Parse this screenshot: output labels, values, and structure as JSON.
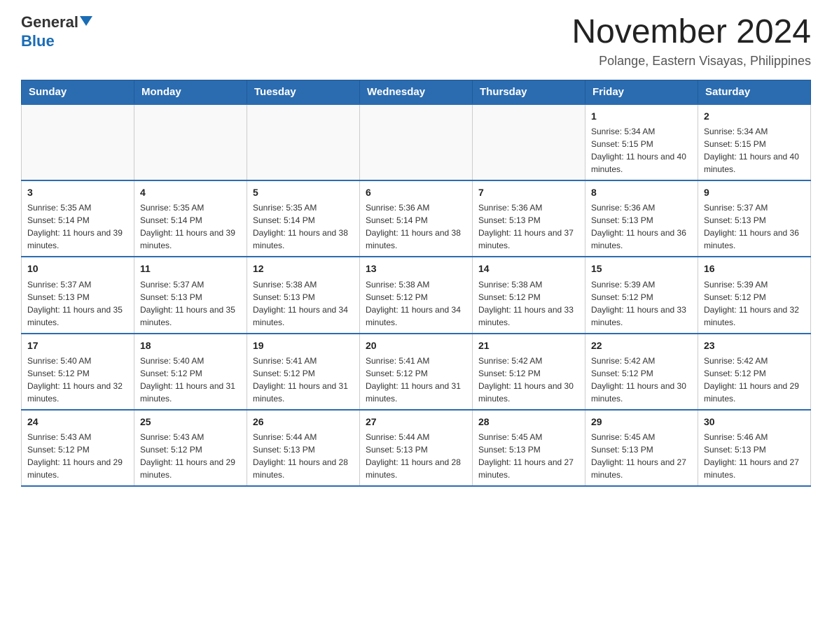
{
  "logo": {
    "text_general": "General",
    "text_blue": "Blue"
  },
  "header": {
    "month_year": "November 2024",
    "location": "Polange, Eastern Visayas, Philippines"
  },
  "days_of_week": [
    "Sunday",
    "Monday",
    "Tuesday",
    "Wednesday",
    "Thursday",
    "Friday",
    "Saturday"
  ],
  "weeks": [
    {
      "days": [
        {
          "num": "",
          "info": ""
        },
        {
          "num": "",
          "info": ""
        },
        {
          "num": "",
          "info": ""
        },
        {
          "num": "",
          "info": ""
        },
        {
          "num": "",
          "info": ""
        },
        {
          "num": "1",
          "info": "Sunrise: 5:34 AM\nSunset: 5:15 PM\nDaylight: 11 hours and 40 minutes."
        },
        {
          "num": "2",
          "info": "Sunrise: 5:34 AM\nSunset: 5:15 PM\nDaylight: 11 hours and 40 minutes."
        }
      ]
    },
    {
      "days": [
        {
          "num": "3",
          "info": "Sunrise: 5:35 AM\nSunset: 5:14 PM\nDaylight: 11 hours and 39 minutes."
        },
        {
          "num": "4",
          "info": "Sunrise: 5:35 AM\nSunset: 5:14 PM\nDaylight: 11 hours and 39 minutes."
        },
        {
          "num": "5",
          "info": "Sunrise: 5:35 AM\nSunset: 5:14 PM\nDaylight: 11 hours and 38 minutes."
        },
        {
          "num": "6",
          "info": "Sunrise: 5:36 AM\nSunset: 5:14 PM\nDaylight: 11 hours and 38 minutes."
        },
        {
          "num": "7",
          "info": "Sunrise: 5:36 AM\nSunset: 5:13 PM\nDaylight: 11 hours and 37 minutes."
        },
        {
          "num": "8",
          "info": "Sunrise: 5:36 AM\nSunset: 5:13 PM\nDaylight: 11 hours and 36 minutes."
        },
        {
          "num": "9",
          "info": "Sunrise: 5:37 AM\nSunset: 5:13 PM\nDaylight: 11 hours and 36 minutes."
        }
      ]
    },
    {
      "days": [
        {
          "num": "10",
          "info": "Sunrise: 5:37 AM\nSunset: 5:13 PM\nDaylight: 11 hours and 35 minutes."
        },
        {
          "num": "11",
          "info": "Sunrise: 5:37 AM\nSunset: 5:13 PM\nDaylight: 11 hours and 35 minutes."
        },
        {
          "num": "12",
          "info": "Sunrise: 5:38 AM\nSunset: 5:13 PM\nDaylight: 11 hours and 34 minutes."
        },
        {
          "num": "13",
          "info": "Sunrise: 5:38 AM\nSunset: 5:12 PM\nDaylight: 11 hours and 34 minutes."
        },
        {
          "num": "14",
          "info": "Sunrise: 5:38 AM\nSunset: 5:12 PM\nDaylight: 11 hours and 33 minutes."
        },
        {
          "num": "15",
          "info": "Sunrise: 5:39 AM\nSunset: 5:12 PM\nDaylight: 11 hours and 33 minutes."
        },
        {
          "num": "16",
          "info": "Sunrise: 5:39 AM\nSunset: 5:12 PM\nDaylight: 11 hours and 32 minutes."
        }
      ]
    },
    {
      "days": [
        {
          "num": "17",
          "info": "Sunrise: 5:40 AM\nSunset: 5:12 PM\nDaylight: 11 hours and 32 minutes."
        },
        {
          "num": "18",
          "info": "Sunrise: 5:40 AM\nSunset: 5:12 PM\nDaylight: 11 hours and 31 minutes."
        },
        {
          "num": "19",
          "info": "Sunrise: 5:41 AM\nSunset: 5:12 PM\nDaylight: 11 hours and 31 minutes."
        },
        {
          "num": "20",
          "info": "Sunrise: 5:41 AM\nSunset: 5:12 PM\nDaylight: 11 hours and 31 minutes."
        },
        {
          "num": "21",
          "info": "Sunrise: 5:42 AM\nSunset: 5:12 PM\nDaylight: 11 hours and 30 minutes."
        },
        {
          "num": "22",
          "info": "Sunrise: 5:42 AM\nSunset: 5:12 PM\nDaylight: 11 hours and 30 minutes."
        },
        {
          "num": "23",
          "info": "Sunrise: 5:42 AM\nSunset: 5:12 PM\nDaylight: 11 hours and 29 minutes."
        }
      ]
    },
    {
      "days": [
        {
          "num": "24",
          "info": "Sunrise: 5:43 AM\nSunset: 5:12 PM\nDaylight: 11 hours and 29 minutes."
        },
        {
          "num": "25",
          "info": "Sunrise: 5:43 AM\nSunset: 5:12 PM\nDaylight: 11 hours and 29 minutes."
        },
        {
          "num": "26",
          "info": "Sunrise: 5:44 AM\nSunset: 5:13 PM\nDaylight: 11 hours and 28 minutes."
        },
        {
          "num": "27",
          "info": "Sunrise: 5:44 AM\nSunset: 5:13 PM\nDaylight: 11 hours and 28 minutes."
        },
        {
          "num": "28",
          "info": "Sunrise: 5:45 AM\nSunset: 5:13 PM\nDaylight: 11 hours and 27 minutes."
        },
        {
          "num": "29",
          "info": "Sunrise: 5:45 AM\nSunset: 5:13 PM\nDaylight: 11 hours and 27 minutes."
        },
        {
          "num": "30",
          "info": "Sunrise: 5:46 AM\nSunset: 5:13 PM\nDaylight: 11 hours and 27 minutes."
        }
      ]
    }
  ]
}
